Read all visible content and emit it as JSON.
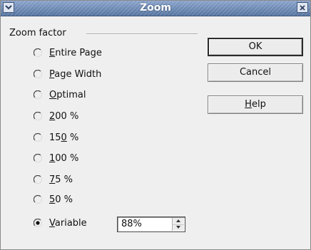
{
  "window": {
    "title": "Zoom"
  },
  "zoom_factor": {
    "group_label": "Zoom factor",
    "options": [
      {
        "label": "Entire Page",
        "mnemonic_index": 0,
        "selected": false
      },
      {
        "label": "Page Width",
        "mnemonic_index": 0,
        "selected": false
      },
      {
        "label": "Optimal",
        "mnemonic_index": 0,
        "selected": false
      },
      {
        "label": "200 %",
        "mnemonic_index": 0,
        "selected": false
      },
      {
        "label": "150 %",
        "mnemonic_index": 2,
        "selected": false
      },
      {
        "label": "100 %",
        "mnemonic_index": 0,
        "selected": false
      },
      {
        "label": "75 %",
        "mnemonic_index": 0,
        "selected": false
      },
      {
        "label": "50 %",
        "mnemonic_index": 0,
        "selected": false
      },
      {
        "label": "Variable",
        "mnemonic_index": 0,
        "selected": true
      }
    ],
    "variable_value": "88%"
  },
  "buttons": {
    "ok": "OK",
    "cancel": "Cancel",
    "help": "Help",
    "help_mnemonic_index": 0
  },
  "icons": {
    "menu": "chevron-down-icon",
    "close": "close-icon",
    "spin_up": "spin-up-arrow-icon",
    "spin_down": "spin-down-arrow-icon"
  }
}
